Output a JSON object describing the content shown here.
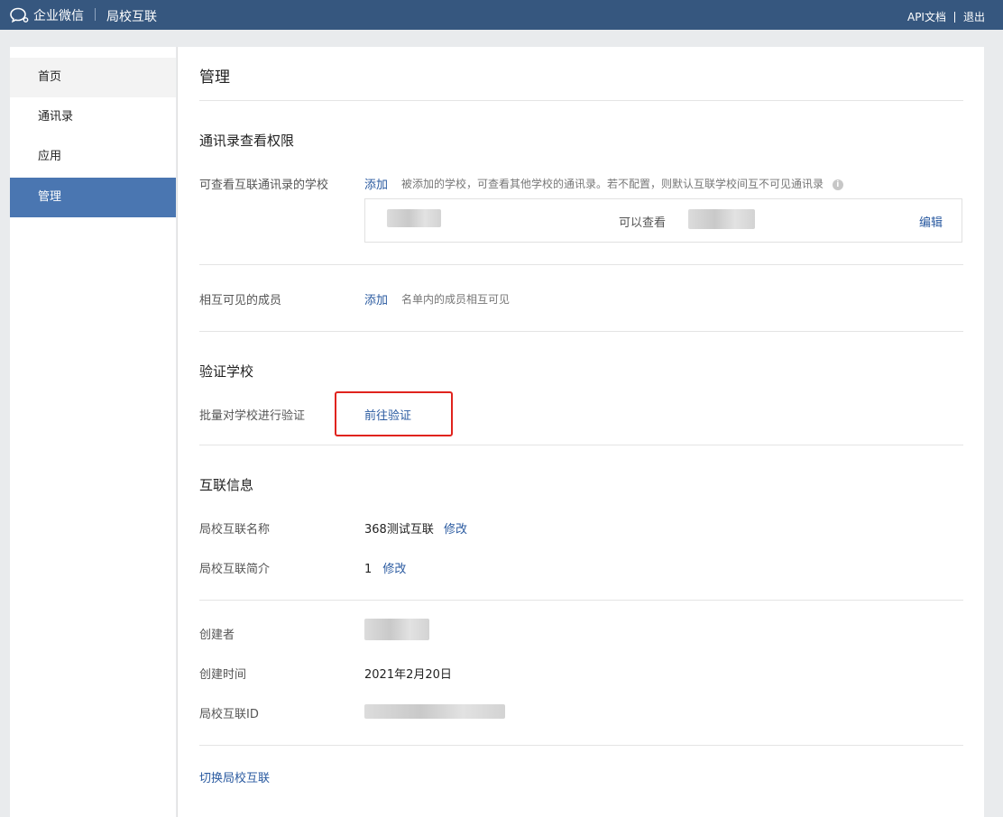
{
  "topbar": {
    "brand": "企业微信",
    "product": "局校互联",
    "links": [
      "API文档",
      "退出"
    ]
  },
  "sidebar": {
    "items": [
      {
        "label": "首页"
      },
      {
        "label": "通讯录"
      },
      {
        "label": "应用"
      },
      {
        "label": "管理"
      }
    ]
  },
  "main": {
    "title": "管理",
    "contacts_section": {
      "title": "通讯录查看权限",
      "row1": {
        "label": "可查看互联通讯录的学校",
        "action": "添加",
        "hint": "被添加的学校，可查看其他学校的通讯录。若不配置，则默认互联学校间互不可见通讯录",
        "box": {
          "middle": "可以查看",
          "edit": "编辑"
        }
      },
      "row2": {
        "label": "相互可见的成员",
        "action": "添加",
        "hint": "名单内的成员相互可见"
      }
    },
    "verify_section": {
      "title": "验证学校",
      "label": "批量对学校进行验证",
      "action": "前往验证"
    },
    "info_section": {
      "title": "互联信息",
      "name_label": "局校互联名称",
      "name_value": "368测试互联",
      "name_edit": "修改",
      "intro_label": "局校互联简介",
      "intro_value": "1",
      "intro_edit": "修改",
      "creator_label": "创建者",
      "created_label": "创建时间",
      "created_value": "2021年2月20日",
      "id_label": "局校互联ID"
    },
    "switch_link": "切换局校互联"
  },
  "colors": {
    "topbar": "#36577f",
    "active_nav": "#4a76b1",
    "link": "#2a5aa0",
    "highlight": "#e0231d"
  }
}
